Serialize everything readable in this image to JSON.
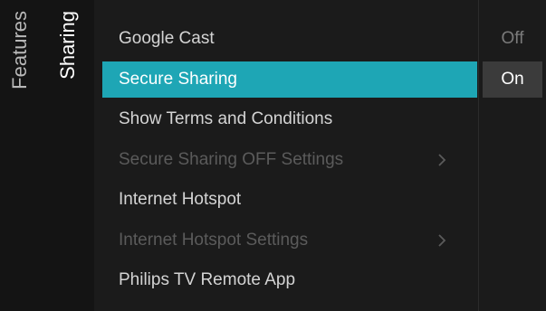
{
  "breadcrumb": {
    "parent": "Features",
    "current": "Sharing"
  },
  "menu": {
    "items": [
      {
        "label": "Google Cast",
        "state": "normal",
        "has_submenu": false
      },
      {
        "label": "Secure Sharing",
        "state": "selected",
        "has_submenu": false
      },
      {
        "label": "Show Terms and Conditions",
        "state": "normal",
        "has_submenu": false
      },
      {
        "label": "Secure Sharing OFF Settings",
        "state": "disabled",
        "has_submenu": true
      },
      {
        "label": "Internet Hotspot",
        "state": "normal",
        "has_submenu": false
      },
      {
        "label": "Internet Hotspot Settings",
        "state": "disabled",
        "has_submenu": true
      },
      {
        "label": "Philips TV Remote App",
        "state": "normal",
        "has_submenu": false
      }
    ]
  },
  "options": {
    "off_label": "Off",
    "on_label": "On",
    "selected": "On"
  },
  "colors": {
    "accent": "#1ea6b5",
    "background": "#141414",
    "panel": "#1b1b1b"
  },
  "icons": {
    "submenu": "chevron-right-icon"
  }
}
